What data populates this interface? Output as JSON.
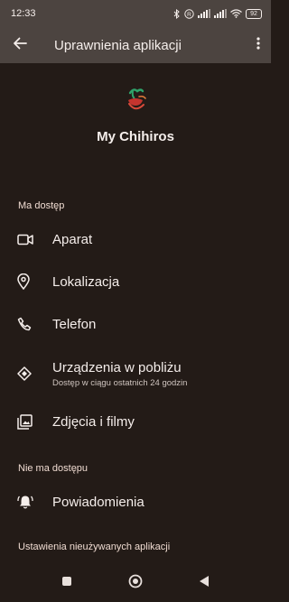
{
  "status_bar": {
    "time": "12:33",
    "battery": "92",
    "icons": [
      "bluetooth-icon",
      "r-badge-icon",
      "signal-icon",
      "signal-icon",
      "wifi-icon",
      "battery-icon"
    ]
  },
  "app_bar": {
    "title": "Uprawnienia aplikacji",
    "back_icon": "arrow-back-icon",
    "more_icon": "more-vert-icon"
  },
  "app": {
    "name": "My Chihiros",
    "icon": "app-logo-icon"
  },
  "sections": {
    "allowed_header": "Ma dostęp",
    "not_allowed_header": "Nie ma dostępu",
    "unused_header": "Ustawienia nieużywanych aplikacji"
  },
  "allowed": [
    {
      "label": "Aparat",
      "icon": "camera-icon"
    },
    {
      "label": "Lokalizacja",
      "icon": "location-pin-icon"
    },
    {
      "label": "Telefon",
      "icon": "phone-icon"
    },
    {
      "label": "Urządzenia w pobliżu",
      "sublabel": "Dostęp w ciągu ostatnich 24 godzin",
      "icon": "nearby-devices-icon"
    },
    {
      "label": "Zdjęcia i filmy",
      "icon": "photos-icon"
    }
  ],
  "not_allowed": [
    {
      "label": "Powiadomienia",
      "icon": "notification-bell-icon"
    }
  ],
  "nav_bar": {
    "icons": [
      "recents-square-icon",
      "home-circle-icon",
      "back-triangle-icon"
    ]
  },
  "colors": {
    "background": "#231b17",
    "app_bar": "#4c4440",
    "text": "#f5eeeb",
    "section_header": "#f0dcd2"
  }
}
